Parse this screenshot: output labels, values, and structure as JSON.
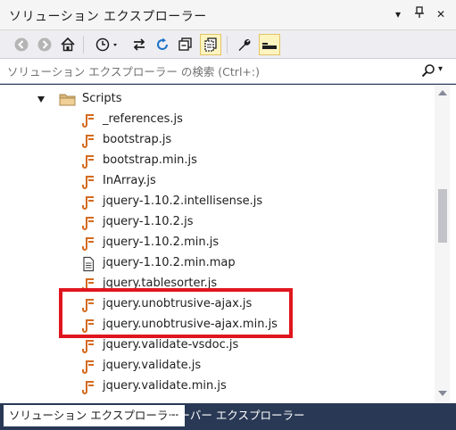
{
  "window": {
    "title": "ソリューション エクスプローラー"
  },
  "search": {
    "placeholder": "ソリューション エクスプローラー の検索 (Ctrl+:)"
  },
  "tree": {
    "folder": "Scripts",
    "files": [
      {
        "name": "_references.js",
        "icon": "js-file-icon"
      },
      {
        "name": "bootstrap.js",
        "icon": "js-file-icon"
      },
      {
        "name": "bootstrap.min.js",
        "icon": "js-file-icon"
      },
      {
        "name": "InArray.js",
        "icon": "js-file-icon"
      },
      {
        "name": "jquery-1.10.2.intellisense.js",
        "icon": "js-file-icon"
      },
      {
        "name": "jquery-1.10.2.js",
        "icon": "js-file-icon"
      },
      {
        "name": "jquery-1.10.2.min.js",
        "icon": "js-file-icon"
      },
      {
        "name": "jquery-1.10.2.min.map",
        "icon": "text-file-icon"
      },
      {
        "name": "jquery.tablesorter.js",
        "icon": "js-file-icon"
      },
      {
        "name": "jquery.unobtrusive-ajax.js",
        "icon": "js-file-icon"
      },
      {
        "name": "jquery.unobtrusive-ajax.min.js",
        "icon": "js-file-icon"
      },
      {
        "name": "jquery.validate-vsdoc.js",
        "icon": "js-file-icon"
      },
      {
        "name": "jquery.validate.js",
        "icon": "js-file-icon"
      },
      {
        "name": "jquery.validate.min.js",
        "icon": "js-file-icon"
      }
    ]
  },
  "tabs": [
    {
      "label": "ソリューション エクスプローラー",
      "active": true
    },
    {
      "label": "サーバー エクスプローラー",
      "active": false
    }
  ],
  "colors": {
    "accent_highlight": "#e0161e",
    "js_icon": "#d46b1f",
    "tab_bar": "#293955"
  }
}
